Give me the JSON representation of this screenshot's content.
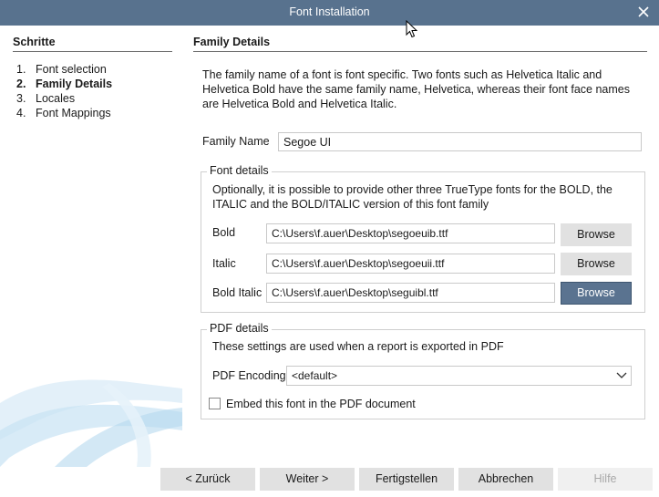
{
  "window": {
    "title": "Font Installation"
  },
  "steps": {
    "heading": "Schritte",
    "items": [
      {
        "num": "1.",
        "label": "Font selection"
      },
      {
        "num": "2.",
        "label": "Family Details"
      },
      {
        "num": "3.",
        "label": "Locales"
      },
      {
        "num": "4.",
        "label": "Font Mappings"
      }
    ]
  },
  "family": {
    "heading": "Family Details",
    "description": "The family name of a font is font specific. Two fonts such as Helvetica Italic and Helvetica Bold have the same family name, Helvetica, whereas their font face names are Helvetica Bold and Helvetica Italic.",
    "name_label": "Family Name",
    "name_value": "Segoe UI"
  },
  "font_details": {
    "title": "Font details",
    "note": "Optionally, it is possible to provide other three TrueType fonts for the BOLD, the ITALIC and the BOLD/ITALIC version of this font family",
    "bold_label": "Bold",
    "bold_path": "C:\\Users\\f.auer\\Desktop\\segoeuib.ttf",
    "italic_label": "Italic",
    "italic_path": "C:\\Users\\f.auer\\Desktop\\segoeuii.ttf",
    "bold_italic_label": "Bold Italic",
    "bold_italic_path": "C:\\Users\\f.auer\\Desktop\\seguibl.ttf",
    "browse_label": "Browse"
  },
  "pdf_details": {
    "title": "PDF details",
    "note": "These settings are used when a report is exported in PDF",
    "encoding_label": "PDF Encoding",
    "encoding_value": "<default>",
    "embed_label": "Embed this font in the PDF document",
    "embed_checked": false
  },
  "buttons": {
    "back": "< Zurück",
    "next": "Weiter >",
    "finish": "Fertigstellen",
    "cancel": "Abbrechen",
    "help": "Hilfe"
  },
  "icons": {
    "close": "close-icon",
    "cursor": "mouse-cursor-icon",
    "dropdown": "chevron-down-icon"
  },
  "colors": {
    "titlebar": "#58728e",
    "focused_button": "#5a7390",
    "button": "#e1e1e1"
  }
}
